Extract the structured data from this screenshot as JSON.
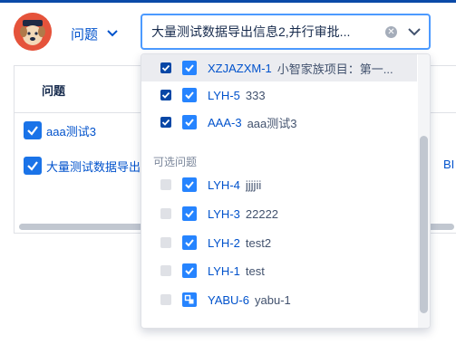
{
  "header": {
    "scope_label": "问题",
    "search_value": "大量测试数据导出信息2,并行审批..."
  },
  "table": {
    "column_issue": "问题",
    "column_other": "",
    "rows": [
      {
        "label": "aaa测试3",
        "extra": ""
      },
      {
        "label": "大量测试数据导出",
        "extra": "BI"
      }
    ]
  },
  "dropdown": {
    "selected": [
      {
        "key": "XZJAZXM-1",
        "summary": "小智家族项目：第一..."
      },
      {
        "key": "LYH-5",
        "summary": "333"
      },
      {
        "key": "AAA-3",
        "summary": "aaa测试3"
      }
    ],
    "section_label": "可选问题",
    "optional": [
      {
        "key": "LYH-4",
        "summary": "jjjjii",
        "icon": "checkbox-task-icon"
      },
      {
        "key": "LYH-3",
        "summary": "22222",
        "icon": "checkbox-task-icon"
      },
      {
        "key": "LYH-2",
        "summary": "test2",
        "icon": "checkbox-task-icon"
      },
      {
        "key": "LYH-1",
        "summary": "test",
        "icon": "checkbox-task-icon"
      },
      {
        "key": "YABU-6",
        "summary": "yabu-1",
        "icon": "subtask-icon"
      }
    ]
  },
  "colors": {
    "accent": "#0052cc",
    "focus_border": "#4c9aff",
    "checked": "#0747a6",
    "avatar_bg": "#e5533b"
  }
}
